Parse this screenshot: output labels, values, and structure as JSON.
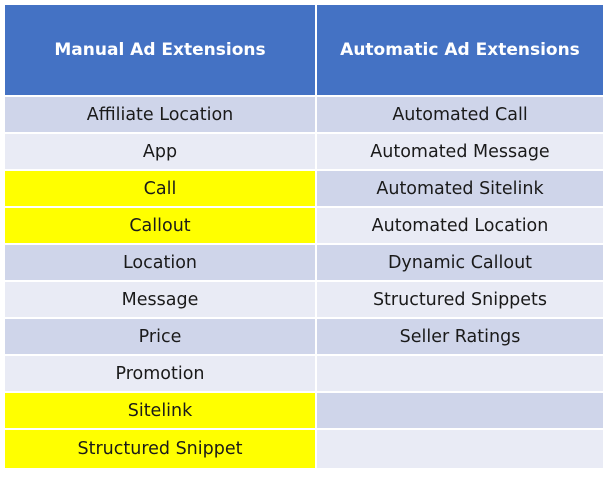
{
  "table": {
    "headers": [
      "Manual Ad Extensions",
      "Automatic Ad Extensions"
    ],
    "highlight_color": "#ffff00",
    "header_color": "#4472c4",
    "rows": [
      {
        "manual": "Affiliate Location",
        "automatic": "Automated Call",
        "manual_highlighted": false
      },
      {
        "manual": "App",
        "automatic": "Automated Message",
        "manual_highlighted": false
      },
      {
        "manual": "Call",
        "automatic": "Automated Sitelink",
        "manual_highlighted": true
      },
      {
        "manual": "Callout",
        "automatic": "Automated Location",
        "manual_highlighted": true
      },
      {
        "manual": "Location",
        "automatic": "Dynamic Callout",
        "manual_highlighted": false
      },
      {
        "manual": "Message",
        "automatic": "Structured Snippets",
        "manual_highlighted": false
      },
      {
        "manual": "Price",
        "automatic": "Seller Ratings",
        "manual_highlighted": false
      },
      {
        "manual": "Promotion",
        "automatic": "",
        "manual_highlighted": false
      },
      {
        "manual": "Sitelink",
        "automatic": "",
        "manual_highlighted": true
      },
      {
        "manual": "Structured Snippet",
        "automatic": "",
        "manual_highlighted": true
      }
    ]
  }
}
